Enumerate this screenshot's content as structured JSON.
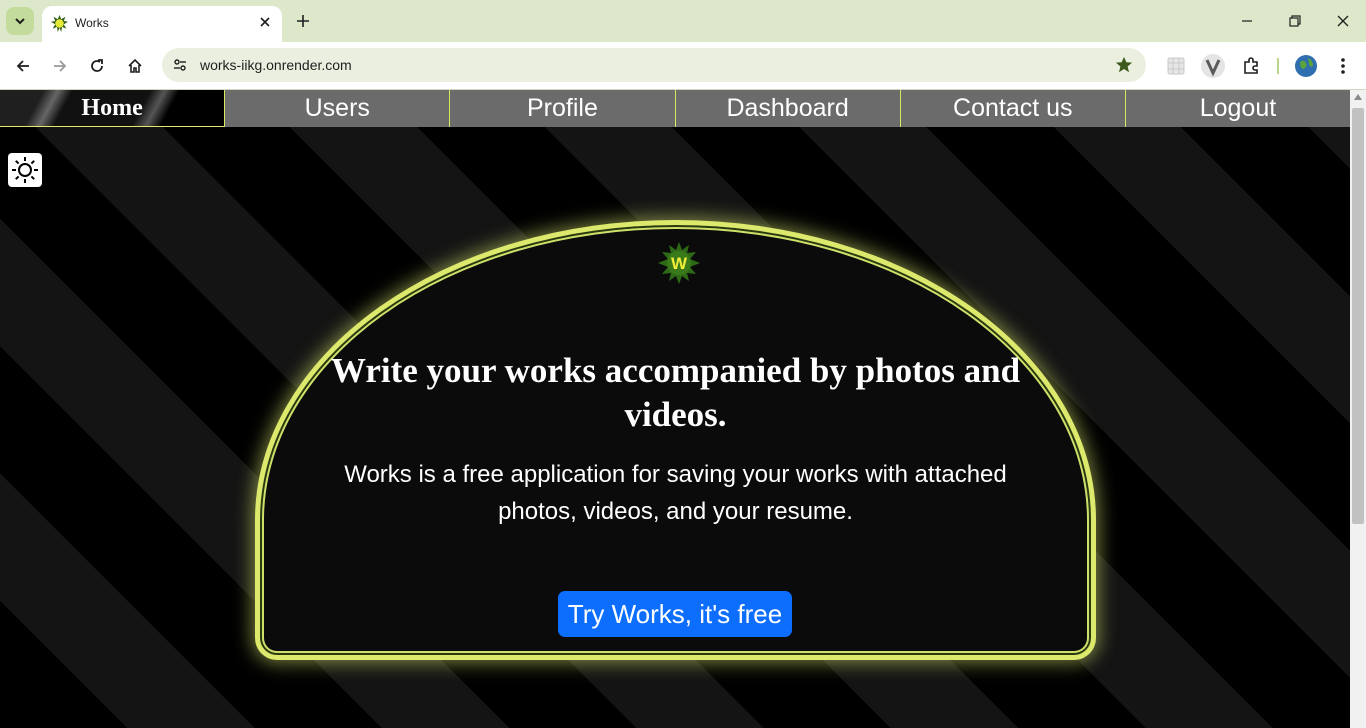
{
  "browser": {
    "tab_title": "Works",
    "url": "works-iikg.onrender.com"
  },
  "site": {
    "nav": [
      "Home",
      "Users",
      "Profile",
      "Dashboard",
      "Contact us",
      "Logout"
    ],
    "active_nav": "Home",
    "logo_letter": "W",
    "hero": {
      "title": "Write your works accompanied by photos and videos.",
      "description": "Works is a free application for saving your works with attached photos, videos, and your resume.",
      "cta_label": "Try Works, it's free"
    }
  },
  "colors": {
    "accent_border": "#dce96c",
    "cta": "#0d6efd",
    "nav_bg": "#6b6b6b",
    "tabstrip": "#dde8ca"
  }
}
